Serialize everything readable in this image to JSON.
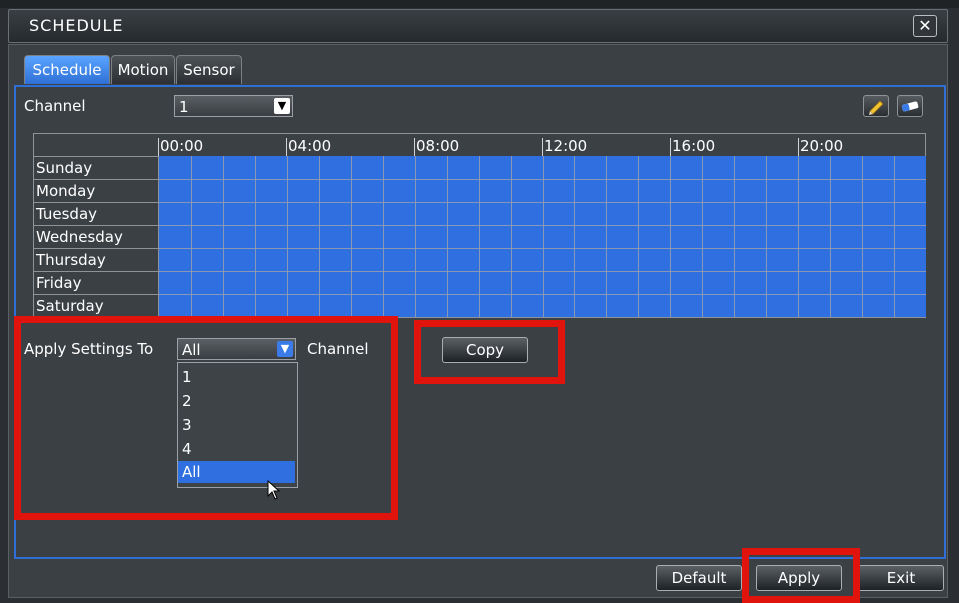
{
  "window": {
    "title": "SCHEDULE",
    "close_glyph": "✕"
  },
  "tabs": [
    {
      "label": "Schedule",
      "active": true
    },
    {
      "label": "Motion",
      "active": false
    },
    {
      "label": "Sensor",
      "active": false
    }
  ],
  "channel": {
    "label": "Channel",
    "value": "1"
  },
  "tools": {
    "edit_icon": "pencil-icon",
    "erase_icon": "eraser-icon"
  },
  "schedule": {
    "hours": [
      "00:00",
      "04:00",
      "08:00",
      "12:00",
      "16:00",
      "20:00"
    ],
    "days": [
      "Sunday",
      "Monday",
      "Tuesday",
      "Wednesday",
      "Thursday",
      "Friday",
      "Saturday"
    ],
    "fill_color": "#2f6fe0",
    "all_scheduled": true
  },
  "apply_settings": {
    "label": "Apply Settings To",
    "value": "All",
    "suffix": "Channel",
    "options": [
      "1",
      "2",
      "3",
      "4",
      "All"
    ],
    "selected": "All"
  },
  "buttons": {
    "copy": "Copy",
    "default": "Default",
    "apply": "Apply",
    "exit": "Exit"
  },
  "colors": {
    "highlight": "#e0140c",
    "accent": "#2f6fe0"
  }
}
